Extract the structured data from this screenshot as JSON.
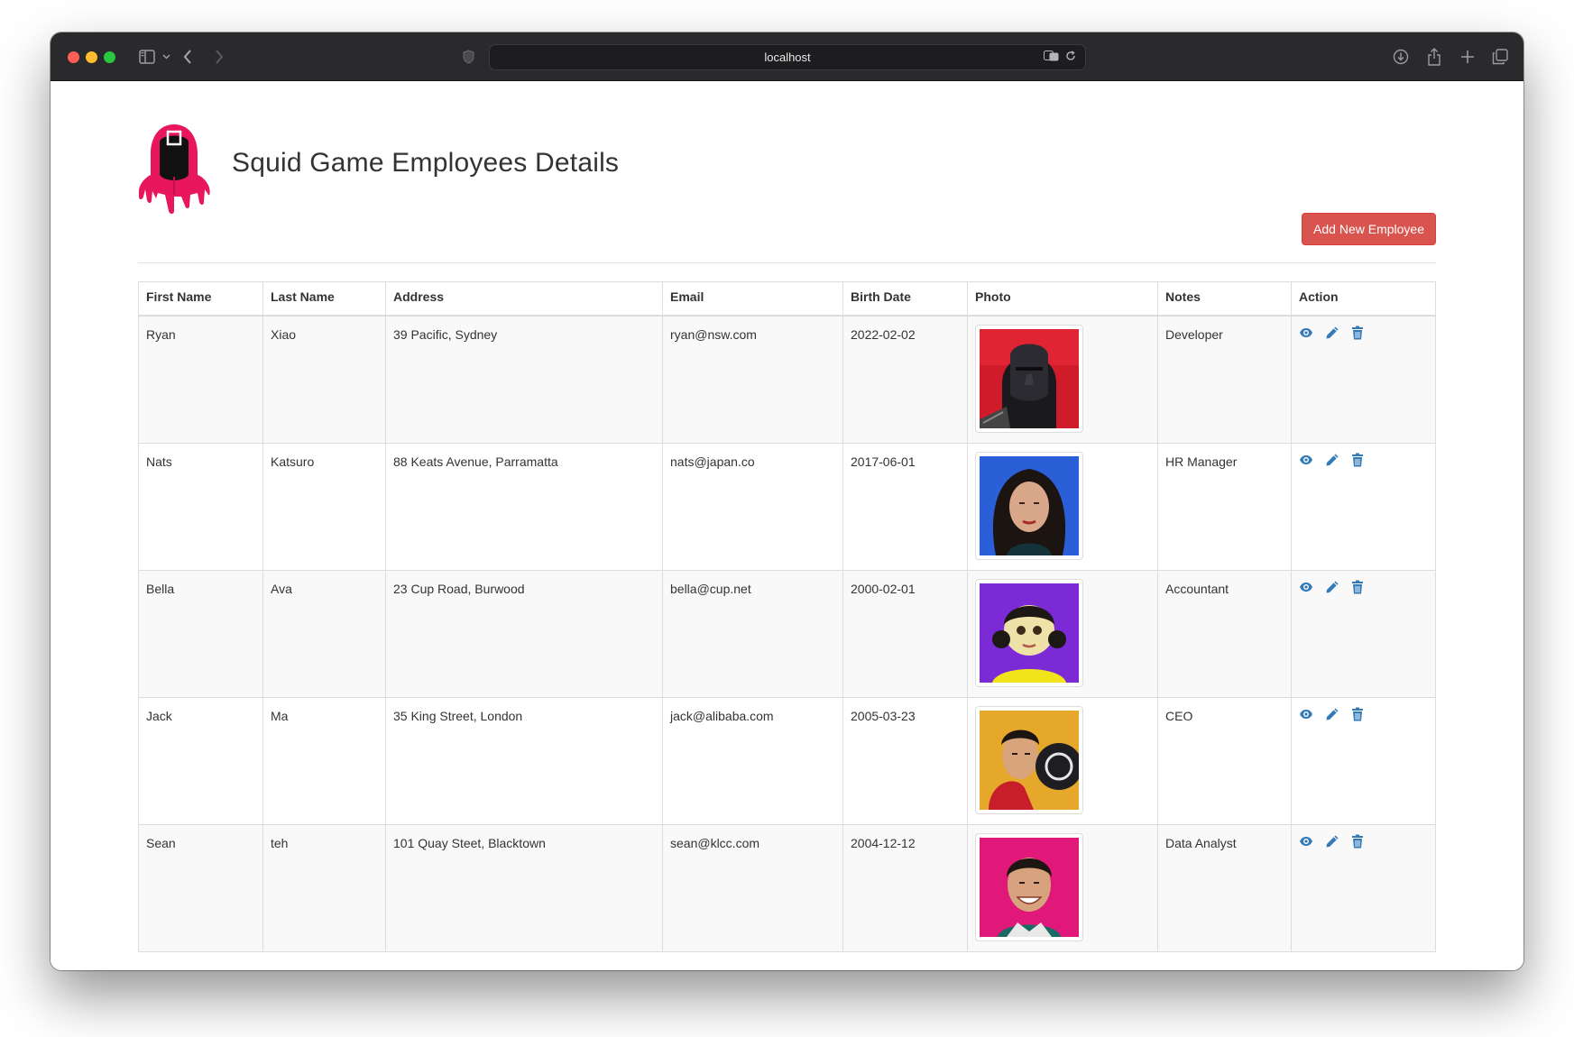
{
  "browser": {
    "url": "localhost"
  },
  "page": {
    "title": "Squid Game Employees Details",
    "add_button": "Add New Employee"
  },
  "table": {
    "headers": [
      "First Name",
      "Last Name",
      "Address",
      "Email",
      "Birth Date",
      "Photo",
      "Notes",
      "Action"
    ],
    "rows": [
      {
        "first": "Ryan",
        "last": "Xiao",
        "address": "39 Pacific, Sydney",
        "email": "ryan@nsw.com",
        "birth": "2022-02-02",
        "photo": "masked-guard-photo",
        "notes": "Developer"
      },
      {
        "first": "Nats",
        "last": "Katsuro",
        "address": "88 Keats Avenue, Parramatta",
        "email": "nats@japan.co",
        "birth": "2017-06-01",
        "photo": "woman-portrait-photo",
        "notes": "HR Manager"
      },
      {
        "first": "Bella",
        "last": "Ava",
        "address": "23 Cup Road, Burwood",
        "email": "bella@cup.net",
        "birth": "2000-02-01",
        "photo": "doll-photo",
        "notes": "Accountant"
      },
      {
        "first": "Jack",
        "last": "Ma",
        "address": "35 King Street, London",
        "email": "jack@alibaba.com",
        "birth": "2005-03-23",
        "photo": "man-with-guard-photo",
        "notes": "CEO"
      },
      {
        "first": "Sean",
        "last": "teh",
        "address": "101 Quay Steet, Blacktown",
        "email": "sean@klcc.com",
        "birth": "2004-12-12",
        "photo": "smiling-man-photo",
        "notes": "Data Analyst"
      }
    ]
  },
  "icons": {
    "view": "eye-icon",
    "edit": "pencil-icon",
    "delete": "trash-icon"
  },
  "colors": {
    "accent_danger": "#d9534f",
    "action_icon": "#337ab7",
    "logo_pink": "#e8175d"
  }
}
